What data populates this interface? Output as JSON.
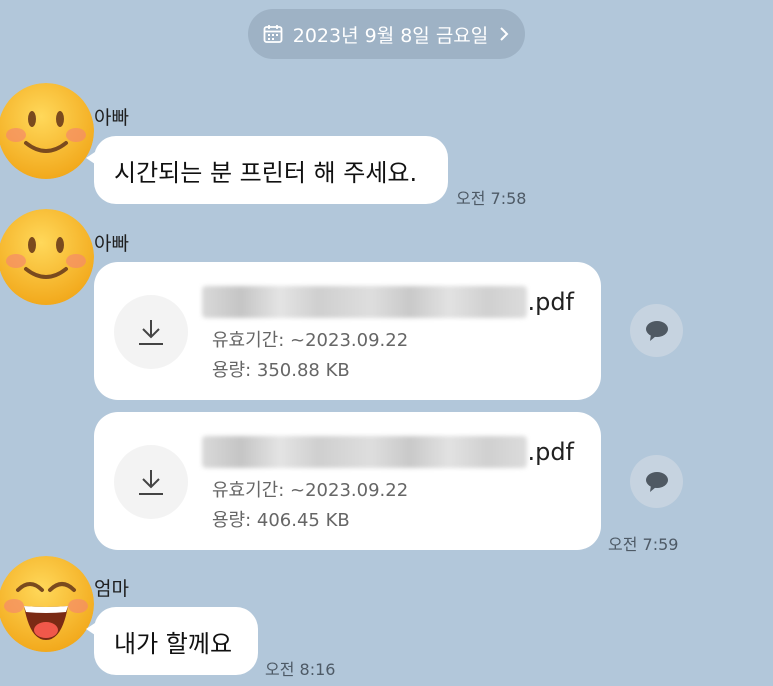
{
  "date_header": {
    "label": "2023년 9월 8일 금요일"
  },
  "messages": [
    {
      "sender": "아빠",
      "text": "시간되는 분 프린터 해 주세요.",
      "time": "오전 7:58"
    },
    {
      "sender": "아빠",
      "time": "오전 7:59",
      "files": [
        {
          "ext": ".pdf",
          "expiry": "유효기간: ~2023.09.22",
          "size": "용량: 350.88 KB"
        },
        {
          "ext": ".pdf",
          "expiry": "유효기간: ~2023.09.22",
          "size": "용량: 406.45 KB"
        }
      ]
    },
    {
      "sender": "엄마",
      "text": "내가 할께요",
      "time": "오전 8:16"
    }
  ],
  "icons": {
    "calendar": "calendar-icon",
    "chevron": "chevron-right-icon",
    "download": "download-icon",
    "share": "share-bubble-icon"
  },
  "colors": {
    "background": "#b2c7da",
    "bubble": "#ffffff",
    "date_pill": "#9eb2c5",
    "emoji_face": "#f7b827"
  }
}
